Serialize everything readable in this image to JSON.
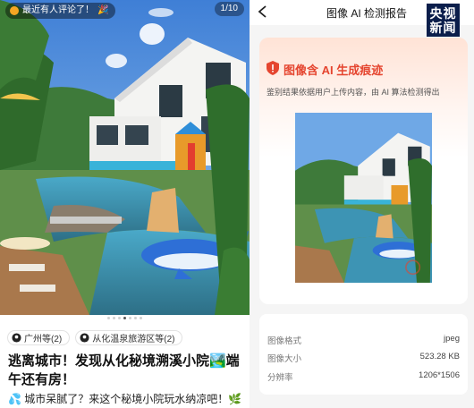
{
  "post": {
    "comment_pill": "最近有人评论了！",
    "image_counter": "1/10",
    "carousel_total": 7,
    "carousel_active": 3,
    "tags": [
      {
        "icon": "location-pin-icon",
        "label": "广州等(2)"
      },
      {
        "icon": "location-pin-icon",
        "label": "从化温泉旅游区等(2)"
      }
    ],
    "title": "逃离城市！发现从化秘境溯溪小院🏞️端午还有房！",
    "description": "💦 城市呆腻了？来这个秘境小院玩水纳凉吧！🌿"
  },
  "report": {
    "back_icon": "back-arrow-icon",
    "title": "图像 AI 检测报告",
    "watermark": "央视新闻",
    "heading": "图像含 AI 生成痕迹",
    "heading_icon": "warning-shield-icon",
    "subtext": "鉴别结果依据用户上传内容，由 AI 算法检测得出",
    "meta": [
      {
        "key": "图像格式",
        "value": "jpeg"
      },
      {
        "key": "图像大小",
        "value": "523.28 KB"
      },
      {
        "key": "分辨率",
        "value": "1206*1506"
      }
    ]
  },
  "colors": {
    "accent_red": "#e5452f",
    "card_top": "#ffe3d6",
    "cctv_navy": "#0b1e4b"
  }
}
